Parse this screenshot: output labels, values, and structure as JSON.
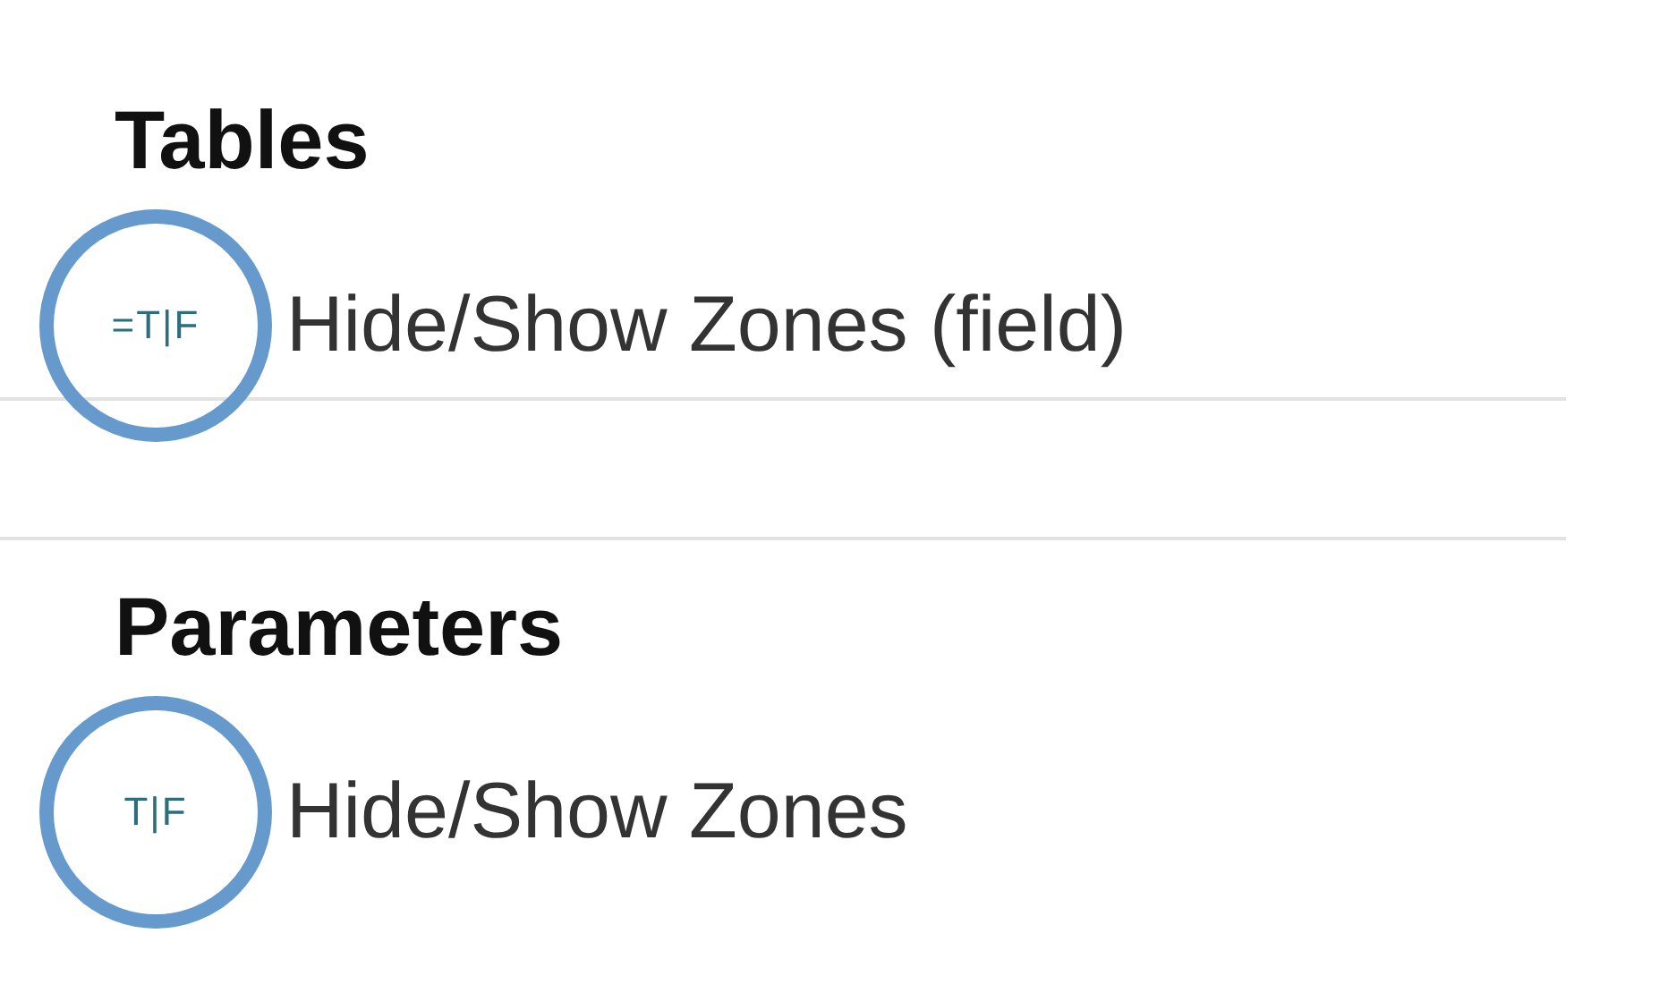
{
  "sections": [
    {
      "title": "Tables",
      "items": [
        {
          "type_icon": "=T|F",
          "label": "Hide/Show Zones (field)",
          "highlighted": true
        }
      ]
    },
    {
      "title": "Parameters",
      "items": [
        {
          "type_icon": "T|F",
          "label": "Hide/Show Zones",
          "highlighted": true
        }
      ]
    }
  ]
}
